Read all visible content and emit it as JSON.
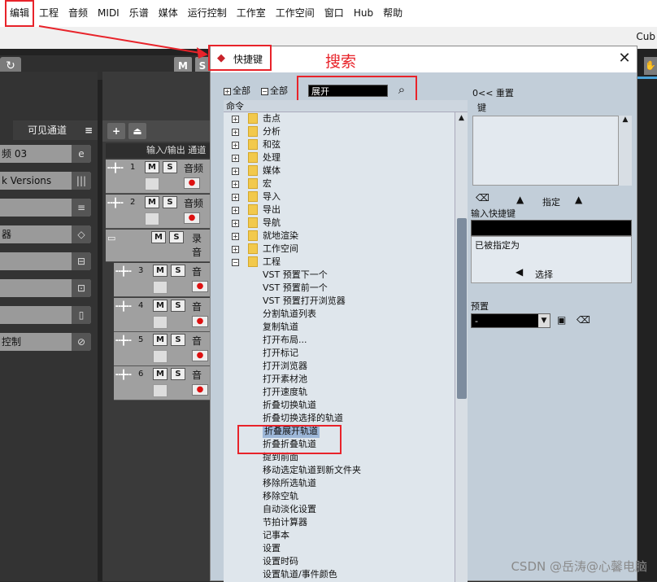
{
  "menubar": {
    "items": [
      "编辑",
      "工程",
      "音频",
      "MIDI",
      "乐谱",
      "媒体",
      "运行控制",
      "工作室",
      "工作空间",
      "窗口",
      "Hub",
      "帮助"
    ]
  },
  "titlestrip": {
    "app_fragment": "Cub"
  },
  "background": {
    "redo_icon": "↻",
    "m_label": "M",
    "s_label": "S",
    "visible_channels_tab": "可见通道",
    "tabs_menu_icon": "≡",
    "left_items": [
      {
        "label": "频 03",
        "icon": "e"
      },
      {
        "label": "k Versions",
        "icon": "|||"
      },
      {
        "label": "",
        "icon": "≡"
      },
      {
        "label": "器",
        "icon": "◇"
      },
      {
        "label": "",
        "icon": "⊟"
      },
      {
        "label": "",
        "icon": "⊡"
      },
      {
        "label": "",
        "icon": "▯"
      },
      {
        "label": "控制",
        "icon": "⊘"
      }
    ],
    "toolbar": {
      "add_icon": "+",
      "folder_icon": "⏏"
    },
    "track_header": "输入/输出 通道",
    "tracks": [
      {
        "num": "1",
        "name": "音频"
      },
      {
        "num": "2",
        "name": "音频"
      },
      {
        "num": "",
        "name": "录音"
      },
      {
        "num": "3",
        "name": "音步"
      },
      {
        "num": "4",
        "name": "音步"
      },
      {
        "num": "5",
        "name": "音步"
      },
      {
        "num": "6",
        "name": "音步"
      }
    ]
  },
  "dialog": {
    "title": "快捷键",
    "close_icon": "✕",
    "expand_all": "全部",
    "collapse_all": "全部",
    "search_value": "展开",
    "search_icon": "🔍",
    "command_header": "命令",
    "tree": [
      {
        "type": "folder",
        "label": "击点",
        "expanded": false
      },
      {
        "type": "folder",
        "label": "分析",
        "expanded": false
      },
      {
        "type": "folder",
        "label": "和弦",
        "expanded": false
      },
      {
        "type": "folder",
        "label": "处理",
        "expanded": false
      },
      {
        "type": "folder",
        "label": "媒体",
        "expanded": false
      },
      {
        "type": "folder",
        "label": "宏",
        "expanded": false
      },
      {
        "type": "folder",
        "label": "导入",
        "expanded": false
      },
      {
        "type": "folder",
        "label": "导出",
        "expanded": false
      },
      {
        "type": "folder",
        "label": "导航",
        "expanded": false
      },
      {
        "type": "folder",
        "label": "就地渲染",
        "expanded": false
      },
      {
        "type": "folder",
        "label": "工作空间",
        "expanded": false
      },
      {
        "type": "folder",
        "label": "工程",
        "expanded": true
      },
      {
        "type": "leaf",
        "label": "VST 预置下一个"
      },
      {
        "type": "leaf",
        "label": "VST 预置前一个"
      },
      {
        "type": "leaf",
        "label": "VST 预置打开浏览器"
      },
      {
        "type": "leaf",
        "label": "分割轨道列表"
      },
      {
        "type": "leaf",
        "label": "复制轨道"
      },
      {
        "type": "leaf",
        "label": "打开布局..."
      },
      {
        "type": "leaf",
        "label": "打开标记"
      },
      {
        "type": "leaf",
        "label": "打开浏览器"
      },
      {
        "type": "leaf",
        "label": "打开素材池"
      },
      {
        "type": "leaf",
        "label": "打开速度轨"
      },
      {
        "type": "leaf",
        "label": "折叠切换轨道"
      },
      {
        "type": "leaf",
        "label": "折叠切换选择的轨道"
      },
      {
        "type": "leaf",
        "label": "折叠展开轨道",
        "selected": true
      },
      {
        "type": "leaf",
        "label": "折叠折叠轨道"
      },
      {
        "type": "leaf",
        "label": "提到前面"
      },
      {
        "type": "leaf",
        "label": "移动选定轨道到新文件夹"
      },
      {
        "type": "leaf",
        "label": "移除所选轨道"
      },
      {
        "type": "leaf",
        "label": "移除空轨"
      },
      {
        "type": "leaf",
        "label": "自动淡化设置"
      },
      {
        "type": "leaf",
        "label": "节拍计算器"
      },
      {
        "type": "leaf",
        "label": "记事本"
      },
      {
        "type": "leaf",
        "label": "设置"
      },
      {
        "type": "leaf",
        "label": "设置时码"
      },
      {
        "type": "leaf",
        "label": "设置轨道/事件颜色"
      }
    ],
    "right_panel": {
      "reset_label": "0<< 重置",
      "keys_label": "键",
      "delete_icon": "🗑",
      "up_icon": "▲",
      "assign_label": "指定",
      "enter_shortcut_label": "输入快捷键",
      "assigned_to_label": "已被指定为",
      "select_icon": "◀",
      "select_label": "选择",
      "presets_label": "预置",
      "preset_value": "-",
      "save_icon": "💾",
      "preset_delete_icon": "🗑"
    }
  },
  "annotation": {
    "search_label": "搜索"
  },
  "watermark": "CSDN @岳涛@心馨电脑"
}
